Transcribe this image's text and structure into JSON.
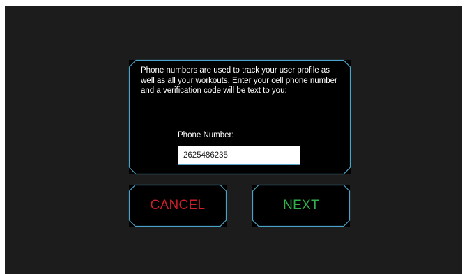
{
  "dialog": {
    "message": "Phone numbers are used to track your user profile as well as all your workouts. Enter your cell phone number and a verification code will be text to you:",
    "phone_label": "Phone Number:",
    "phone_value": "2625486235"
  },
  "buttons": {
    "cancel_label": "CANCEL",
    "next_label": "NEXT"
  },
  "colors": {
    "background": "#1c1c1c",
    "panel": "#000000",
    "frame_border": "#4aa3c8",
    "cancel_text": "#cc1f2a",
    "next_text": "#2fb04a"
  }
}
